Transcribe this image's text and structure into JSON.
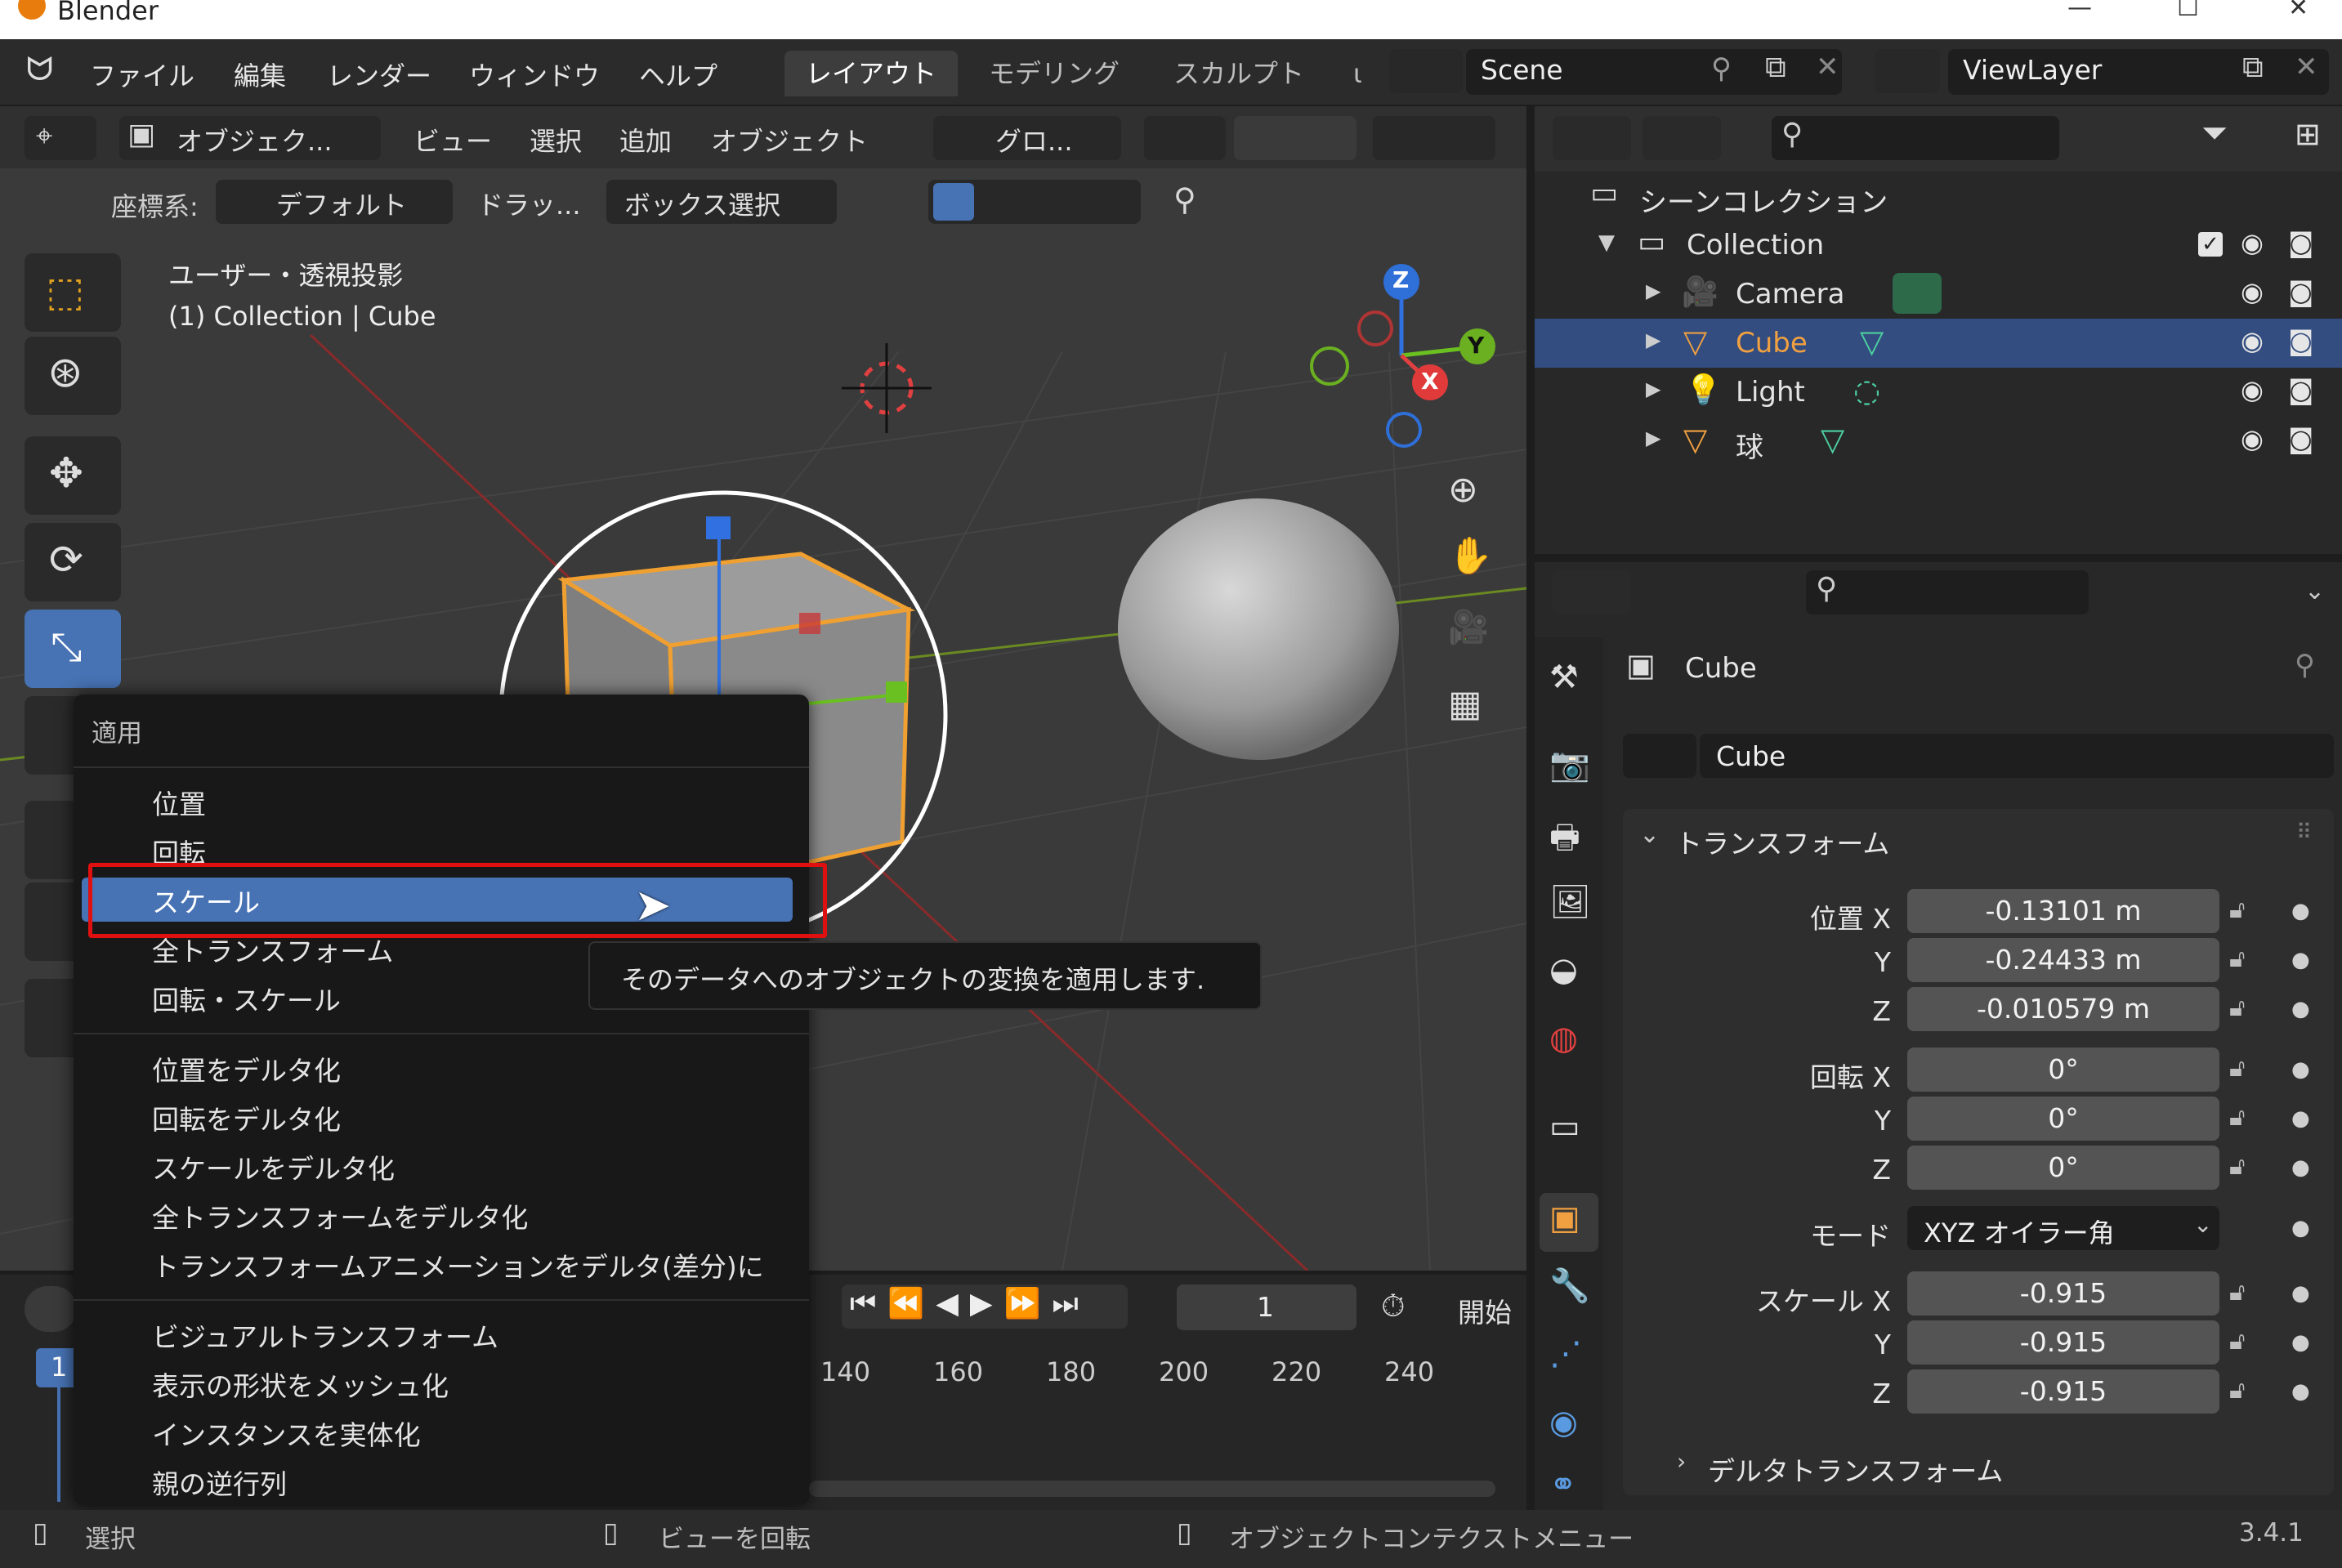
{
  "titlebar": {
    "app_name": "Blender",
    "minimize": "—",
    "maximize": "☐",
    "close": "✕"
  },
  "menubar": {
    "items": [
      "ファイル",
      "編集",
      "レンダー",
      "ウィンドウ",
      "ヘルプ"
    ],
    "workspaces": [
      "レイアウト",
      "モデリング",
      "スカルプト",
      "ι"
    ],
    "scene": "Scene",
    "view_layer": "ViewLayer"
  },
  "viewport_header": {
    "mode": "オブジェク...",
    "menus": [
      "ビュー",
      "選択",
      "追加",
      "オブジェクト"
    ],
    "transform_orientation": "グロ...",
    "row2_label": "座標系:",
    "coord_value": "デフォルト",
    "drag_label": "ドラッ...",
    "box_select": "ボックス選択"
  },
  "viewport_overlay": {
    "view_name": "ユーザー・透視投影",
    "collection_object": "(1) Collection | Cube"
  },
  "gizmo": {
    "z": "Z",
    "y": "Y",
    "x": "X"
  },
  "context_menu": {
    "title": "適用",
    "group1": [
      "位置",
      "回転",
      "スケール",
      "全トランスフォーム",
      "回転・スケール"
    ],
    "group2": [
      "位置をデルタ化",
      "回転をデルタ化",
      "スケールをデルタ化",
      "全トランスフォームをデルタ化",
      "トランスフォームアニメーションをデルタ(差分)に"
    ],
    "group3": [
      "ビジュアルトランスフォーム",
      "表示の形状をメッシュ化",
      "インスタンスを実体化",
      "親の逆行列"
    ],
    "highlighted": "スケール",
    "tooltip": "そのデータへのオブジェクトの変換を適用します."
  },
  "timeline": {
    "current_frame": "1",
    "start_label": "開始",
    "frame_marker": "1",
    "ticks": [
      "140",
      "160",
      "180",
      "200",
      "220",
      "240"
    ]
  },
  "outliner": {
    "scene_collection": "シーンコレクション",
    "collection": "Collection",
    "objects": [
      {
        "name": "Camera",
        "selected": false
      },
      {
        "name": "Cube",
        "selected": true
      },
      {
        "name": "Light",
        "selected": false
      },
      {
        "name": "球",
        "selected": false
      }
    ]
  },
  "properties": {
    "object_name": "Cube",
    "data_name": "Cube",
    "panel_title": "トランスフォーム",
    "location": {
      "label": "位置 X",
      "x": "-0.13101 m",
      "y": "-0.24433 m",
      "z": "-0.010579 m"
    },
    "rotation": {
      "label": "回転 X",
      "x": "0°",
      "y": "0°",
      "z": "0°"
    },
    "mode_label": "モード",
    "mode_value": "XYZ オイラー角",
    "scale": {
      "label": "スケール X",
      "x": "-0.915",
      "y": "-0.915",
      "z": "-0.915"
    },
    "axis_y": "Y",
    "axis_z": "Z",
    "delta_panel": "デルタトランスフォーム"
  },
  "statusbar": {
    "select": "選択",
    "rotate_view": "ビューを回転",
    "context_menu": "オブジェクトコンテクストメニュー",
    "version": "3.4.1"
  },
  "colors": {
    "accent": "#4772b3",
    "selection_orange": "#f0a030",
    "highlight_red": "#e01010"
  }
}
